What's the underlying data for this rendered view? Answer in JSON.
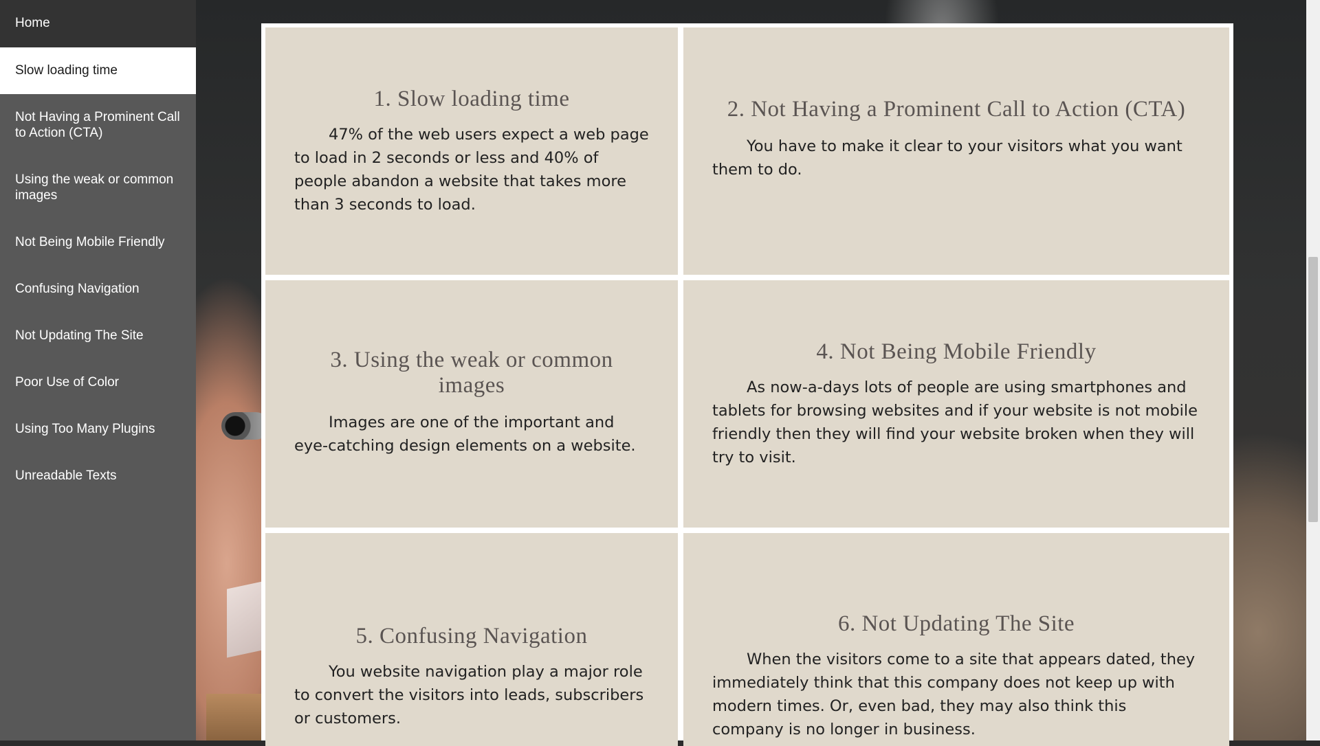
{
  "sidebar": {
    "items": [
      {
        "label": "Home"
      },
      {
        "label": "Slow loading time"
      },
      {
        "label": "Not Having a Prominent Call to Action (CTA)"
      },
      {
        "label": "Using the weak or common images"
      },
      {
        "label": "Not Being Mobile Friendly"
      },
      {
        "label": "Confusing Navigation"
      },
      {
        "label": "Not Updating The Site"
      },
      {
        "label": "Poor Use of Color"
      },
      {
        "label": "Using Too Many Plugins"
      },
      {
        "label": "Unreadable Texts"
      }
    ],
    "active_index": 1
  },
  "cards": [
    {
      "title": "1. Slow loading time",
      "body": "47% of the web users expect a web page to load in 2 seconds or less and 40% of people abandon a website that takes more than 3 seconds to load."
    },
    {
      "title": "2. Not Having a Prominent Call to Action (CTA)",
      "body": "You have to make it clear to your visitors what you want them to do."
    },
    {
      "title": "3. Using the weak or common images",
      "body": "Images are one of the important and eye-catching design elements on a website."
    },
    {
      "title": "4. Not Being Mobile Friendly",
      "body": "As now-a-days lots of people are using smartphones and tablets for browsing websites and if your website is not mobile friendly then they will find your website broken when they will try to visit."
    },
    {
      "title": "5. Confusing Navigation",
      "body": "You website navigation play a major role to convert the visitors into leads, subscribers or customers."
    },
    {
      "title": "6. Not Updating The Site",
      "body": "When the visitors come to a site that appears dated, they immediately think that this company does not keep up with modern times. Or, even bad, they may also think this company is no longer in business."
    }
  ],
  "colors": {
    "sidebar_bg": "#585858",
    "home_bg": "#333333",
    "active_bg": "#ffffff",
    "card_bg": "#e0d9cc",
    "heading": "#5a5452"
  }
}
